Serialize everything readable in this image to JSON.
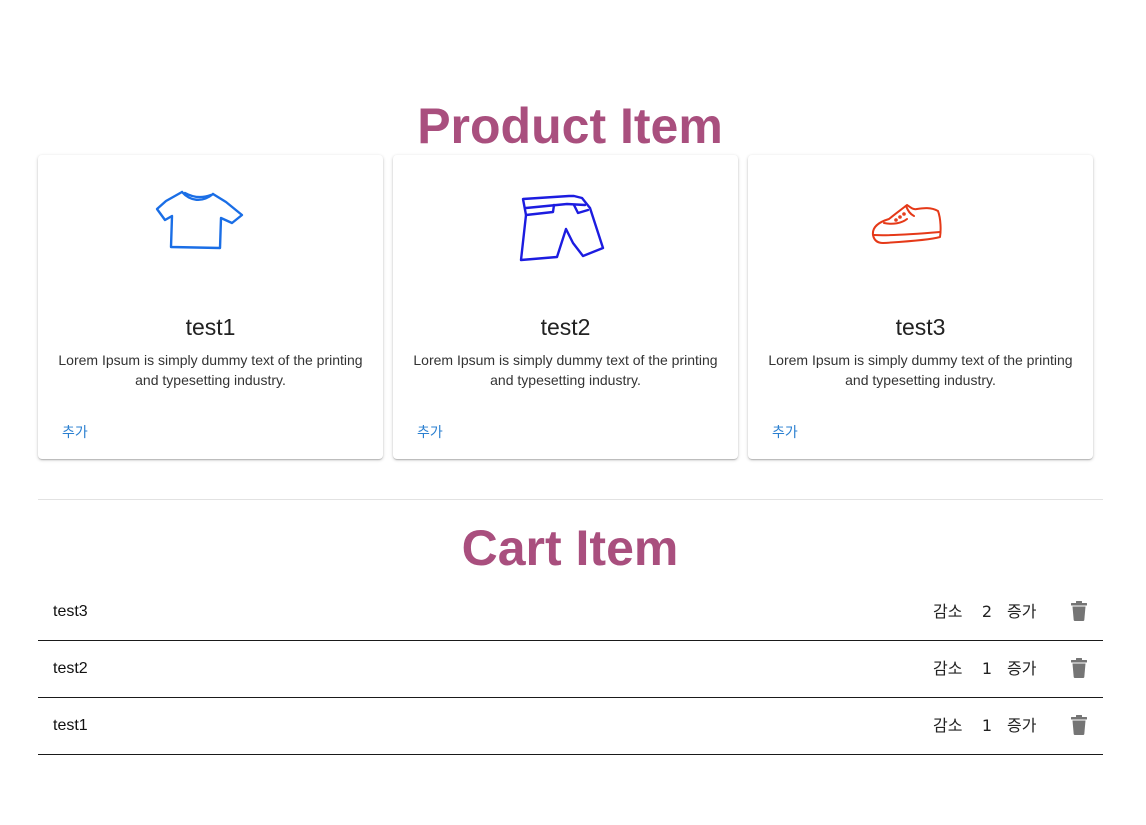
{
  "products_title": "Product Item",
  "cart_title": "Cart Item",
  "colors": {
    "title": "#a94f7e",
    "shirt_icon": "#1a6ee6",
    "shorts_icon": "#1c1ce0",
    "shoe_icon": "#e53918",
    "add_button": "#2a7fd0",
    "trash_icon": "#757575"
  },
  "products": [
    {
      "name": "test1",
      "icon": "tshirt-icon",
      "description": "Lorem Ipsum is simply dummy text of the printing and typesetting industry.",
      "add_label": "추가"
    },
    {
      "name": "test2",
      "icon": "shorts-icon",
      "description": "Lorem Ipsum is simply dummy text of the printing and typesetting industry.",
      "add_label": "추가"
    },
    {
      "name": "test3",
      "icon": "sneaker-icon",
      "description": "Lorem Ipsum is simply dummy text of the printing and typesetting industry.",
      "add_label": "추가"
    }
  ],
  "cart": [
    {
      "name": "test3",
      "decrease_label": "감소",
      "quantity": "2",
      "increase_label": "증가",
      "delete_icon": "trash-icon"
    },
    {
      "name": "test2",
      "decrease_label": "감소",
      "quantity": "1",
      "increase_label": "증가",
      "delete_icon": "trash-icon"
    },
    {
      "name": "test1",
      "decrease_label": "감소",
      "quantity": "1",
      "increase_label": "증가",
      "delete_icon": "trash-icon"
    }
  ]
}
